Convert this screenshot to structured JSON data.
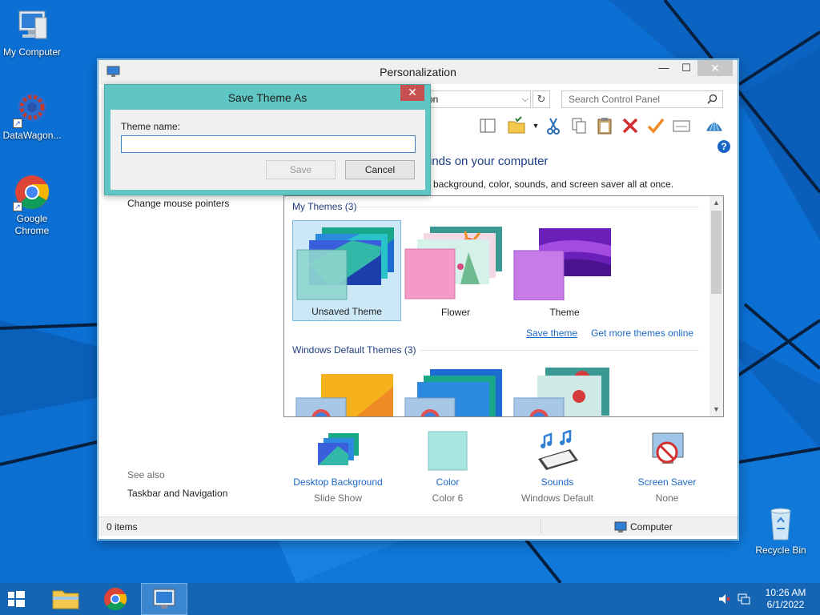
{
  "desktop": {
    "icons": [
      {
        "label": "My Computer"
      },
      {
        "label": "DataWagon..."
      },
      {
        "label": "Google Chrome"
      },
      {
        "label": "Recycle Bin"
      }
    ]
  },
  "window": {
    "title": "Personalization",
    "address_value": "on",
    "search_placeholder": "Search Control Panel",
    "heading": "unds on your computer",
    "subheading": "p background, color, sounds, and screen saver all at once.",
    "left_links": {
      "change_mouse_pointers": "Change mouse pointers",
      "see_also": "See also",
      "taskbar_navigation": "Taskbar and Navigation"
    },
    "my_themes": {
      "label": "My Themes (3)",
      "themes": [
        {
          "name": "Unsaved Theme",
          "selected": true
        },
        {
          "name": "Flower",
          "selected": false
        },
        {
          "name": "Theme",
          "selected": false
        }
      ],
      "save_theme_link": "Save theme",
      "more_themes_link": "Get more themes online"
    },
    "default_themes": {
      "label": "Windows Default Themes (3)"
    },
    "bottom_items": [
      {
        "link": "Desktop Background",
        "value": "Slide Show"
      },
      {
        "link": "Color",
        "value": "Color 6"
      },
      {
        "link": "Sounds",
        "value": "Windows Default"
      },
      {
        "link": "Screen Saver",
        "value": "None"
      }
    ],
    "status": {
      "items": "0 items",
      "location": "Computer"
    }
  },
  "dialog": {
    "title": "Save Theme As",
    "label": "Theme name:",
    "input_value": "",
    "save_label": "Save",
    "cancel_label": "Cancel",
    "close_glyph": "✕"
  },
  "taskbar": {
    "time": "10:26 AM",
    "date": "6/1/2022"
  },
  "colors": {
    "desktop_bg": "#0d72d6",
    "dialog_frame": "#5fc6c4",
    "link": "#1c68c6",
    "taskbar": "#1565b3"
  }
}
